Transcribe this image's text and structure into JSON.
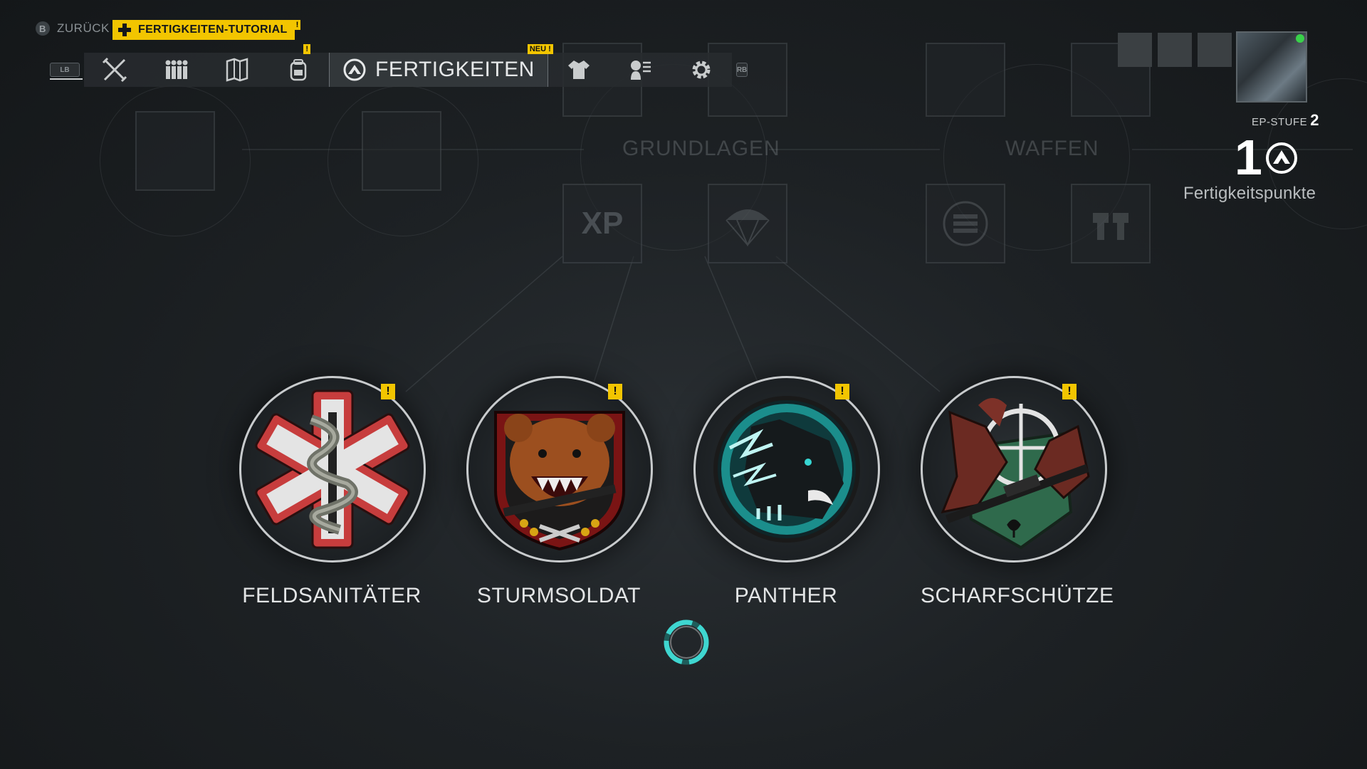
{
  "top": {
    "back_button_glyph": "B",
    "back_label": "ZURÜCK",
    "tutorial_label": "FERTIGKEITEN-TUTORIAL",
    "tutorial_badge": "!"
  },
  "nav": {
    "left_bumper": "LB",
    "right_bumper": "RB",
    "active_label": "FERTIGKEITEN",
    "new_badge": "NEU !",
    "backpack_badge": "!",
    "items": [
      {
        "icon": "crossed-weapons-icon"
      },
      {
        "icon": "squad-icon"
      },
      {
        "icon": "map-icon"
      },
      {
        "icon": "backpack-icon"
      },
      {
        "icon": "skills-icon",
        "active": true
      },
      {
        "icon": "outfit-icon"
      },
      {
        "icon": "intel-icon"
      },
      {
        "icon": "settings-icon"
      }
    ]
  },
  "profile": {
    "ep_label": "EP-STUFE",
    "ep_level": "2",
    "skill_points": "1",
    "skill_points_label": "Fertigkeitspunkte"
  },
  "tree": {
    "grundlagen": "GRUNDLAGEN",
    "waffen": "WAFFEN",
    "xp_badge": "XP"
  },
  "classes": [
    {
      "name": "FELDSANITÄTER",
      "alert": "!"
    },
    {
      "name": "STURMSOLDAT",
      "alert": "!"
    },
    {
      "name": "PANTHER",
      "alert": "!"
    },
    {
      "name": "SCHARFSCHÜTZE",
      "alert": "!"
    }
  ],
  "colors": {
    "accent_yellow": "#f2c500",
    "online_green": "#39d14a",
    "spinner_cyan": "#3fd6d0"
  }
}
